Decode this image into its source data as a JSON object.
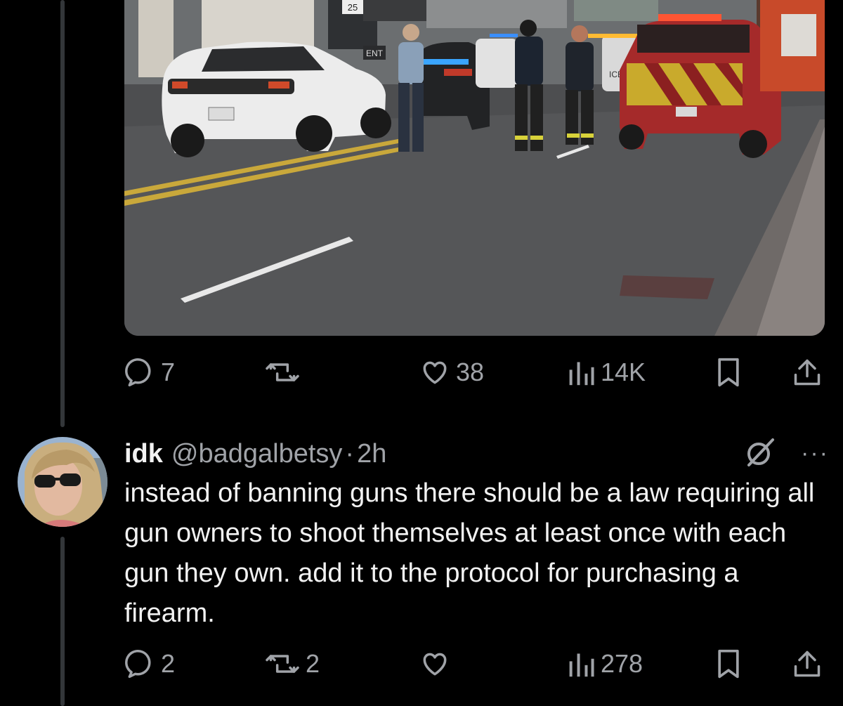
{
  "photo": {
    "signs": {
      "parking_number": "25",
      "entry_sign": "ENT"
    },
    "vehicle_text": {
      "police_marking": "ICE"
    }
  },
  "tweet_top": {
    "actions": {
      "replies": "7",
      "reposts": "",
      "likes": "38",
      "views": "14K"
    }
  },
  "reply": {
    "author_name": "idk",
    "author_handle": "@badgalbetsy",
    "separator": "·",
    "time": "2h",
    "more_label": "···",
    "text": "instead of banning guns there should be a law requiring all gun owners to shoot themselves at least once with each gun they own. add it to the protocol for purchasing a firearm.",
    "actions": {
      "replies": "2",
      "reposts": "2",
      "likes": "",
      "views": "278"
    }
  },
  "icons": {
    "reply": "reply-bubble-icon",
    "repost": "repost-arrows-icon",
    "like": "heart-icon",
    "views": "bar-chart-icon",
    "bookmark": "bookmark-icon",
    "share": "share-upload-icon",
    "grok": "grok-icon",
    "more": "more-dots-icon"
  },
  "colors": {
    "background": "#000000",
    "text": "#e7e9ea",
    "secondary": "#a0a3a8",
    "thread_line": "#333639"
  }
}
